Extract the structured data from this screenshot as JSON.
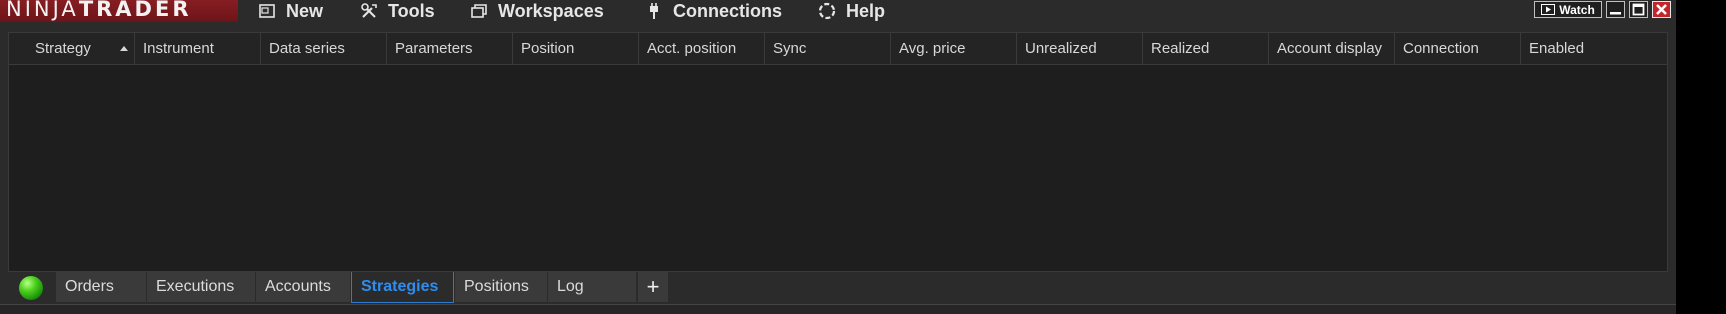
{
  "app": {
    "brand_light": "NINJA",
    "brand_bold": "TRADER"
  },
  "menu": {
    "items": [
      {
        "label": "New",
        "icon": "new-window-icon"
      },
      {
        "label": "Tools",
        "icon": "tools-icon"
      },
      {
        "label": "Workspaces",
        "icon": "workspaces-icon"
      },
      {
        "label": "Connections",
        "icon": "plug-icon"
      },
      {
        "label": "Help",
        "icon": "help-icon"
      }
    ]
  },
  "window_controls": {
    "watch_label": "Watch",
    "minimize": "minimize-icon",
    "maximize": "maximize-icon",
    "close": "close-icon"
  },
  "grid": {
    "columns": [
      "Strategy",
      "Instrument",
      "Data series",
      "Parameters",
      "Position",
      "Acct. position",
      "Sync",
      "Avg. price",
      "Unrealized",
      "Realized",
      "Account display",
      "Connection",
      "Enabled"
    ],
    "rows": []
  },
  "tabs": {
    "items": [
      {
        "label": "Orders",
        "active": false
      },
      {
        "label": "Executions",
        "active": false
      },
      {
        "label": "Accounts",
        "active": false
      },
      {
        "label": "Strategies",
        "active": true
      },
      {
        "label": "Positions",
        "active": false
      },
      {
        "label": "Log",
        "active": false
      }
    ],
    "add_label": "+"
  },
  "colors": {
    "accent": "#2f8df0",
    "brand_red": "#8b1f24",
    "status_green": "#4ed21d"
  }
}
